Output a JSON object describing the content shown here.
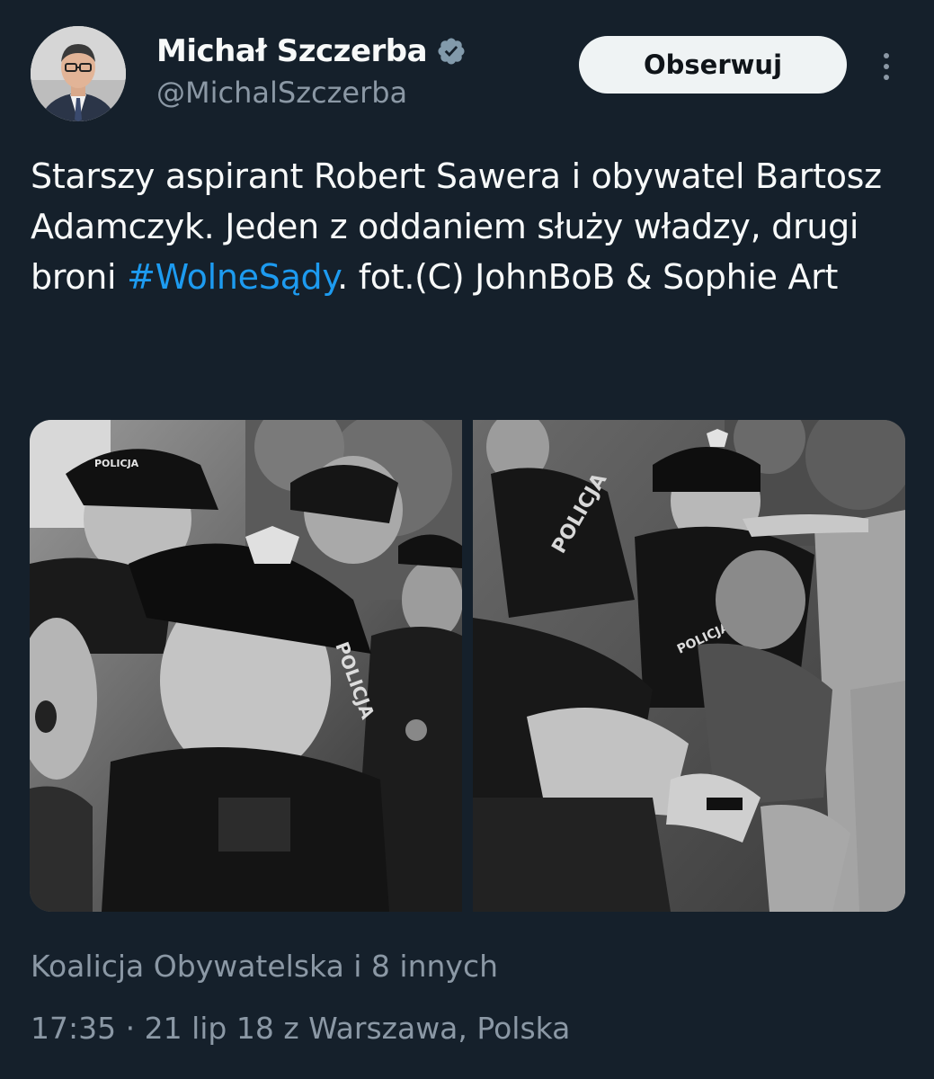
{
  "author": {
    "display_name": "Michał Szczerba",
    "handle": "@MichalSzczerba",
    "verified_icon": "verified-badge-icon",
    "avatar_icon": "profile-photo"
  },
  "actions": {
    "follow_label": "Obserwuj",
    "more_icon": "more-options-icon"
  },
  "tweet": {
    "text_before": "Starszy aspirant Robert Sawera i obywatel Bartosz Adamczyk. Jeden z oddaniem służy władzy, drugi broni ",
    "hashtag": "#WolneSądy",
    "text_after": ". fot.(C) JohnBoB & Sophie Art"
  },
  "media": [
    {
      "name": "photo-police-group"
    },
    {
      "name": "photo-police-detaining"
    }
  ],
  "photo_lettering": {
    "cap_label": "POLICJA",
    "shoulder_label": "POLICJA",
    "sleeve_label": "POLICJA",
    "back_label": "POLICJA"
  },
  "social_context": "Koalicja Obywatelska i 8 innych",
  "meta": {
    "time": "17:35",
    "separator": " · ",
    "date": "21 lip 18",
    "location": " z Warszawa, Polska"
  },
  "colors": {
    "background": "#15202b",
    "text": "#f7f9f9",
    "secondary": "#8b98a5",
    "link": "#1d9bf0",
    "verified": "#829aab",
    "button_bg": "#eff3f4"
  }
}
